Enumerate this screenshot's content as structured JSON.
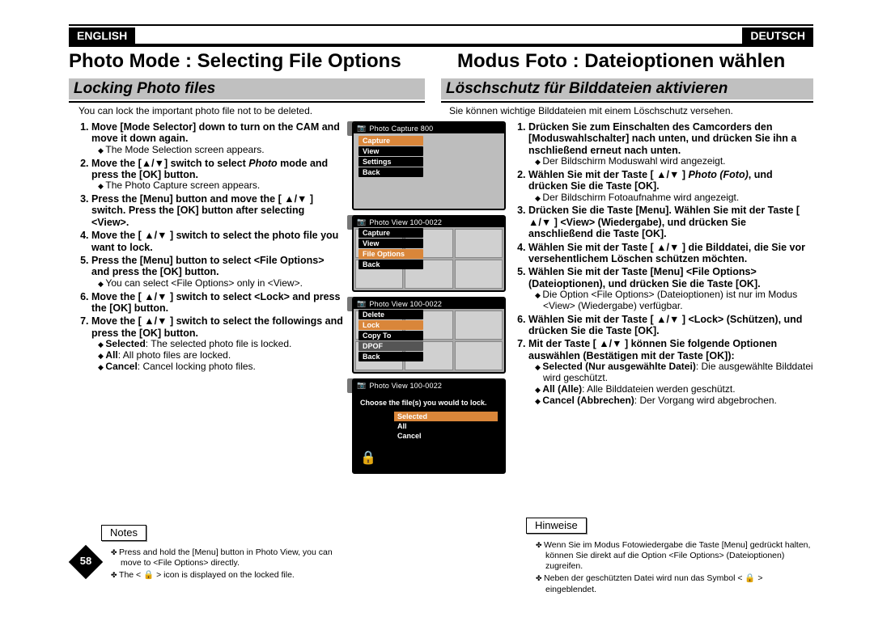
{
  "lang": {
    "en": "ENGLISH",
    "de": "DEUTSCH"
  },
  "title": {
    "en": "Photo Mode : Selecting File Options",
    "de": "Modus Foto : Dateioptionen wählen"
  },
  "sub": {
    "en": "Locking Photo files",
    "de": "Löschschutz für Bilddateien aktivieren"
  },
  "intro": {
    "en": "You can lock the important photo file not to be deleted.",
    "de": "Sie können wichtige Bilddateien mit einem Löschschutz versehen."
  },
  "steps_en": [
    {
      "t": "Move [Mode Selector] down to turn on the CAM and move it down again.",
      "b": [
        "The Mode Selection screen appears."
      ]
    },
    {
      "t_pre": "Move the [",
      "t_post": "] switch to select ",
      "t_ital": "Photo",
      "t_end": " mode and press the [OK] button.",
      "b": [
        "The Photo Capture screen appears."
      ]
    },
    {
      "t": "Press the [Menu] button and move the [ ▲/▼ ] switch. Press the [OK] button after selecting <View>."
    },
    {
      "t": "Move the [ ▲/▼ ] switch to select the photo file you want to lock."
    },
    {
      "t": "Press the [Menu] button to select <File Options> and press the [OK] button.",
      "b": [
        "You can select <File Options> only in <View>."
      ]
    },
    {
      "t": "Move the [ ▲/▼ ] switch to select <Lock> and press the [OK] button."
    },
    {
      "t": "Move the [ ▲/▼ ] switch to select the followings and press the [OK] button.",
      "sel": [
        {
          "k": "Selected",
          "v": ": The selected photo file is locked."
        },
        {
          "k": "All",
          "v": ": All photo files are locked."
        },
        {
          "k": "Cancel",
          "v": ": Cancel locking photo files."
        }
      ]
    }
  ],
  "steps_de": [
    {
      "t": "Drücken Sie zum Einschalten des Camcorders den [Moduswahlschalter] nach unten, und drücken Sie ihn a nschließend erneut nach unten.",
      "b": [
        "Der Bildschirm Moduswahl wird angezeigt."
      ]
    },
    {
      "t_pre": "Wählen Sie mit der Taste [ ▲/▼ ] ",
      "t_ital": "Photo (Foto)",
      "t_end": ", und drücken Sie die Taste [OK].",
      "b": [
        "Der Bildschirm Fotoaufnahme wird angezeigt."
      ]
    },
    {
      "t": "Drücken Sie die Taste [Menu]. Wählen Sie mit der Taste [ ▲/▼ ] <View> (Wiedergabe), und drücken Sie anschließend die Taste [OK]."
    },
    {
      "t": "Wählen Sie mit der Taste [ ▲/▼ ] die Bilddatei, die Sie vor versehentlichem Löschen schützen möchten."
    },
    {
      "t": "Wählen Sie mit der Taste [Menu] <File Options> (Dateioptionen), und drücken Sie die Taste [OK].",
      "b": [
        "Die Option <File Options> (Dateioptionen) ist nur im Modus <View> (Wiedergabe) verfügbar."
      ]
    },
    {
      "t": "Wählen Sie mit der Taste [ ▲/▼ ] <Lock> (Schützen), und drücken Sie die Taste [OK]."
    },
    {
      "t": "Mit der Taste [ ▲/▼ ] können Sie folgende Optionen auswählen (Bestätigen mit der Taste [OK]):",
      "sel": [
        {
          "k": "Selected (Nur ausgewählte Datei)",
          "v": ": Die ausgewählte Bilddatei wird geschützt."
        },
        {
          "k": "All (Alle)",
          "v": ": Alle Bilddateien werden geschützt."
        },
        {
          "k": "Cancel (Abbrechen)",
          "v": ": Der Vorgang wird abgebrochen."
        }
      ]
    }
  ],
  "notes_label": {
    "en": "Notes",
    "de": "Hinweise"
  },
  "notes_en": [
    "Press and hold the [Menu] button in Photo View, you can move to <File Options> directly.",
    "The < 🔒 > icon is displayed on the locked file."
  ],
  "notes_de": [
    "Wenn Sie im Modus Fotowiedergabe die Taste [Menu] gedrückt halten, können Sie direkt auf die Option <File Options> (Dateioptionen) zugreifen.",
    "Neben der geschützten Datei wird nun das Symbol < 🔒 > eingeblendet."
  ],
  "page_number": "58",
  "shots": {
    "s3": {
      "num": "3",
      "bar": "Photo Capture     800",
      "menu": [
        "Capture",
        "View",
        "Settings",
        "Back"
      ],
      "sel": 0
    },
    "s5": {
      "num": "5",
      "bar": "Photo View 100-0022",
      "menu": [
        "Capture",
        "View",
        "File Options",
        "Back"
      ],
      "sel": 2
    },
    "s6": {
      "num": "6",
      "bar": "Photo View 100-0022",
      "menu": [
        "Delete",
        "Lock",
        "Copy To",
        "DPOF",
        "Back"
      ],
      "sel": 1
    },
    "s7": {
      "num": "7",
      "bar": "Photo View 100-0022",
      "prompt": "Choose the file(s) you would to lock.",
      "opts": [
        "Selected",
        "All",
        "Cancel"
      ],
      "sel": 0
    }
  }
}
